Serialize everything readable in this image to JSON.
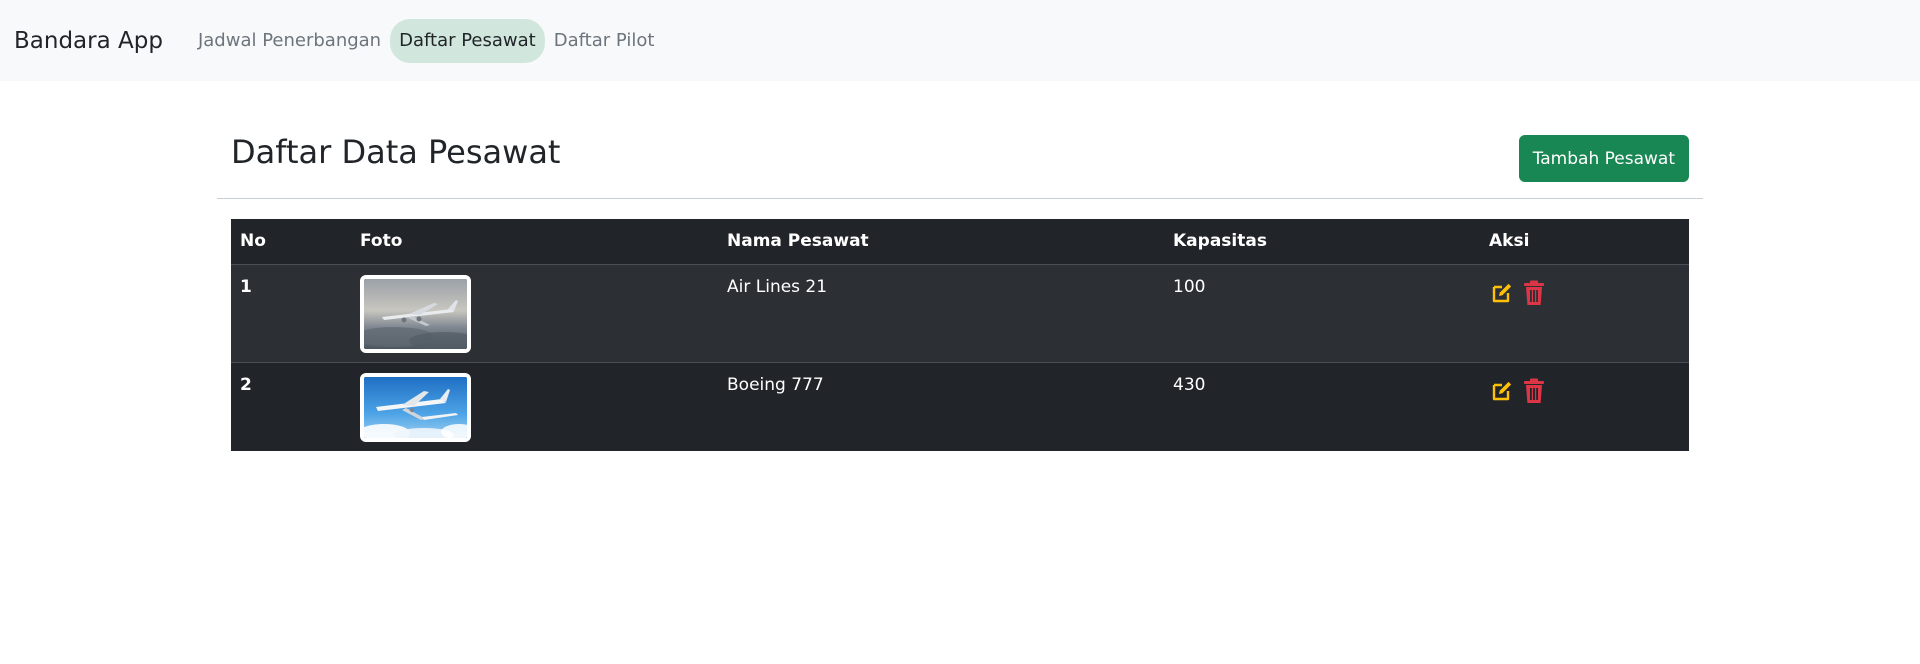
{
  "nav": {
    "brand": "Bandara App",
    "links": [
      {
        "label": "Jadwal Penerbangan",
        "active": false
      },
      {
        "label": "Daftar Pesawat",
        "active": true
      },
      {
        "label": "Daftar Pilot",
        "active": false
      }
    ]
  },
  "page": {
    "title": "Daftar Data Pesawat",
    "add_button_label": "Tambah Pesawat"
  },
  "table": {
    "headers": [
      "No",
      "Foto",
      "Nama Pesawat",
      "Kapasitas",
      "Aksi"
    ],
    "rows": [
      {
        "no": "1",
        "nama": "Air Lines 21",
        "kapasitas": "100",
        "photo": "airliner-cloudy-sky-photo"
      },
      {
        "no": "2",
        "nama": "Boeing 777",
        "kapasitas": "430",
        "photo": "airliner-blue-sky-photo"
      }
    ]
  },
  "colors": {
    "nav_bg": "#f8f9fa",
    "active_pill": "#d1e7dd",
    "primary_green": "#198754",
    "table_dark": "#212529",
    "edit_icon": "#ffc107",
    "delete_icon": "#dc3545"
  },
  "icons": {
    "edit": "edit-icon",
    "delete": "trash-icon"
  }
}
